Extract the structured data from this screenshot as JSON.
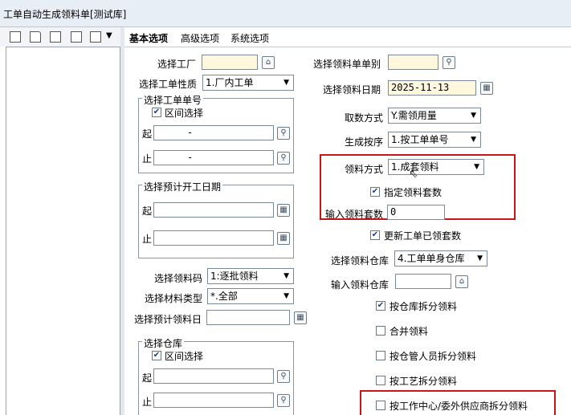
{
  "window": {
    "title": "工单自动生成领料单[测试库]"
  },
  "tabs": [
    "基本选项",
    "高级选项",
    "系统选项"
  ],
  "left": {
    "factory_label": "选择工厂",
    "order_nature_label": "选择工单性质",
    "order_nature_value": "1.厂内工单",
    "order_no_group": "选择工单单号",
    "range_select_label": "区间选择",
    "from_label": "起",
    "to_label": "止",
    "from_value": "-",
    "to_value": "-",
    "start_date_group": "选择预计开工日期",
    "material_code_label": "选择领料码",
    "material_code_value": "1:逐批领料",
    "material_type_label": "选择材料类型",
    "material_type_value": "*.全部",
    "plan_date_label": "选择预计领料日",
    "warehouse_group": "选择仓库",
    "wh_range_label": "区间选择"
  },
  "right": {
    "doc_type_label": "选择领料单单别",
    "date_label": "选择领料日期",
    "date_value": "2025-11-13",
    "fetch_label": "取数方式",
    "fetch_value": "Y.需领用量",
    "order_label": "生成按序",
    "order_value": "1.按工单单号",
    "pick_method_label": "领料方式",
    "pick_method_value": "1.成套领料",
    "specify_sets_label": "指定领料套数",
    "input_sets_label": "输入领料套数",
    "input_sets_value": "0",
    "update_sets_label": "更新工单已领套数",
    "pick_wh_label": "选择领料仓库",
    "pick_wh_value": "4.工单单身仓库",
    "input_wh_label": "输入领料仓库",
    "split_wh_label": "按仓库拆分领料",
    "merge_label": "合并领料",
    "split_keeper_label": "按仓管人员拆分领料",
    "split_process_label": "按工艺拆分领料",
    "split_center_label": "按工作中心/委外供应商拆分领料"
  },
  "checks": {
    "range_select": true,
    "specify_sets": true,
    "update_sets": true,
    "split_wh": true,
    "merge": false,
    "split_keeper": false,
    "split_process": false,
    "split_center": false,
    "wh_range": true
  },
  "icons": {
    "home": "⌂",
    "calendar": "▦",
    "lookup": "🔍",
    "check": "✔"
  }
}
